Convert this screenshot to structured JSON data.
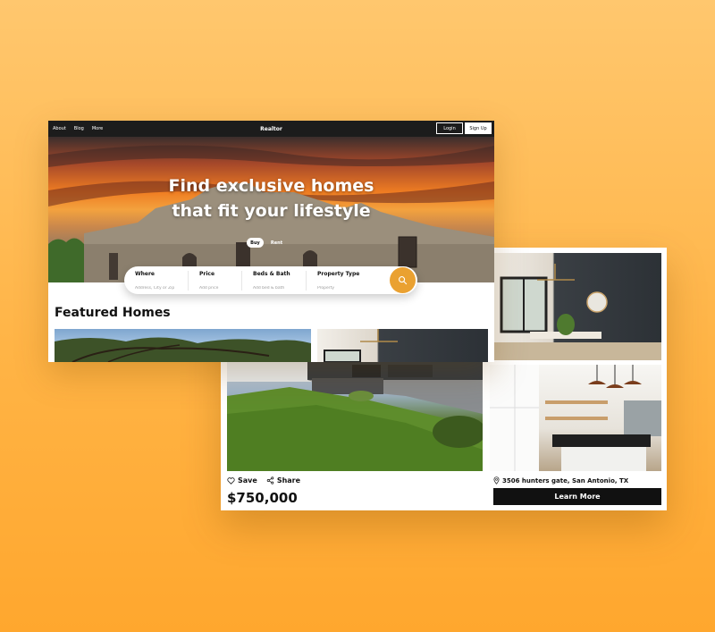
{
  "nav": {
    "links": [
      "About",
      "Blog",
      "More"
    ],
    "brand": "Realtor",
    "login_label": "Login",
    "signup_label": "Sign Up"
  },
  "hero": {
    "title_line1": "Find exclusive homes",
    "title_line2": "that fit your lifestyle",
    "toggle": {
      "buy": "Buy",
      "rent": "Rent",
      "selected": "Buy"
    }
  },
  "search": {
    "fields": [
      {
        "label": "Where",
        "placeholder": "Address, City or Zip"
      },
      {
        "label": "Price",
        "placeholder": "Add price"
      },
      {
        "label": "Beds & Bath",
        "placeholder": "Add bed & bath"
      },
      {
        "label": "Property Type",
        "placeholder": "Property"
      }
    ],
    "button_icon": "search-icon"
  },
  "featured": {
    "heading": "Featured Homes"
  },
  "listing": {
    "save_label": "Save",
    "share_label": "Share",
    "price": "$750,000",
    "address": "3506 hunters gate, San Antonio, TX",
    "cta_label": "Learn More"
  },
  "colors": {
    "accent": "#eaa131",
    "dark": "#1c1c1c",
    "background_top": "#ffc76e",
    "background_bottom": "#ffa72e"
  }
}
